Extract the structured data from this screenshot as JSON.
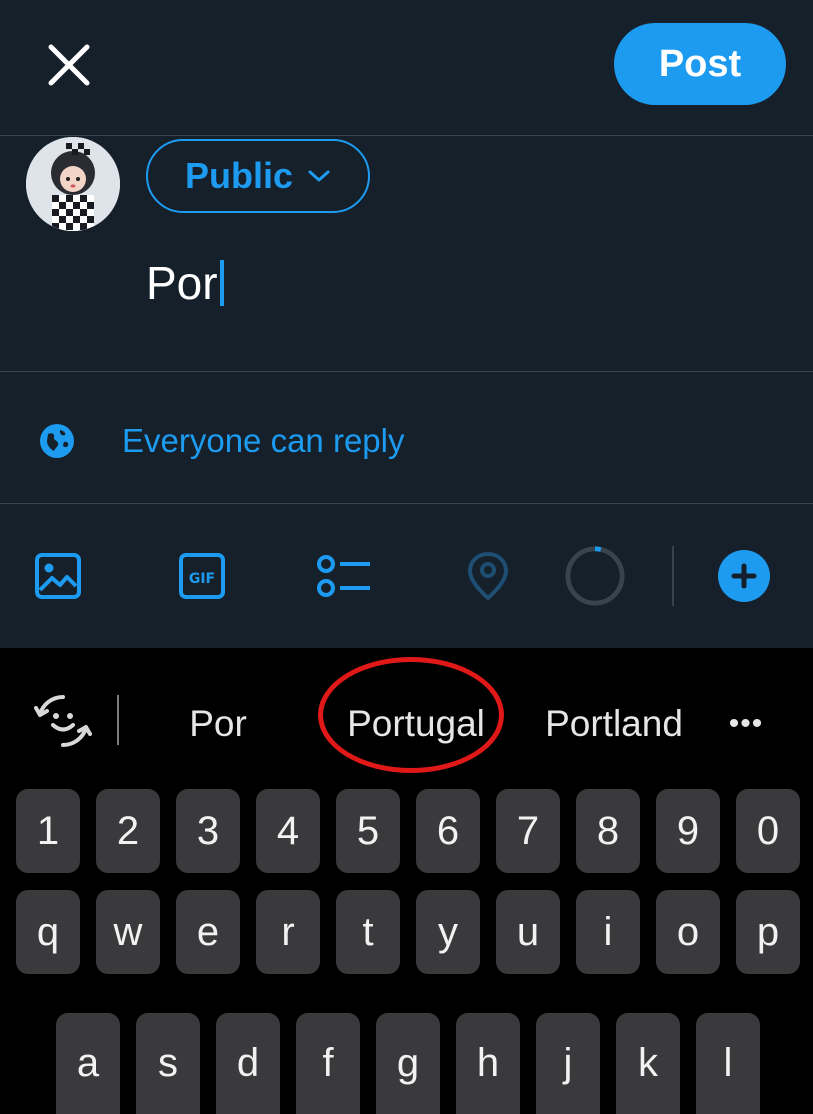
{
  "header": {
    "post_label": "Post"
  },
  "compose": {
    "audience_label": "Public",
    "text": "Por"
  },
  "reply_setting": {
    "label": "Everyone can reply"
  },
  "toolbar": {
    "icons": [
      "image-icon",
      "gif-icon",
      "poll-icon",
      "location-icon",
      "character-counter",
      "add-icon"
    ]
  },
  "keyboard": {
    "suggestions": [
      "Por",
      "Portugal",
      "Portland"
    ],
    "more": "•••",
    "number_row": [
      "1",
      "2",
      "3",
      "4",
      "5",
      "6",
      "7",
      "8",
      "9",
      "0"
    ],
    "row_q": [
      "q",
      "w",
      "e",
      "r",
      "t",
      "y",
      "u",
      "i",
      "o",
      "p"
    ],
    "row_a": [
      "a",
      "s",
      "d",
      "f",
      "g",
      "h",
      "j",
      "k",
      "l"
    ]
  },
  "colors": {
    "background": "#15202b",
    "accent": "#1d9bf0",
    "keyboard_bg": "#000000",
    "key_bg": "#3a3a3c",
    "annotation_circle": "#e01818"
  }
}
